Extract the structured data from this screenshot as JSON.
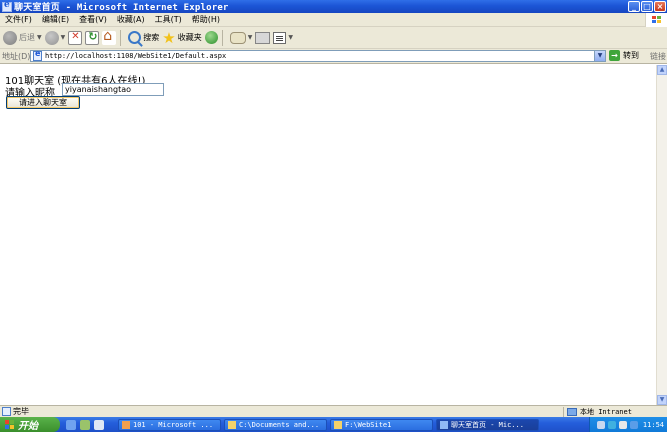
{
  "window": {
    "title": "聊天室首页 - Microsoft Internet Explorer",
    "min": "_",
    "max": "□",
    "close": "×"
  },
  "menu": [
    "文件(F)",
    "编辑(E)",
    "查看(V)",
    "收藏(A)",
    "工具(T)",
    "帮助(H)"
  ],
  "toolbar": {
    "back": "后退",
    "search": "搜索",
    "favorites": "收藏夹"
  },
  "address": {
    "label": "地址(D)",
    "url": "http://localhost:1108/WebSite1/Default.aspx",
    "go": "转到",
    "links": "链接"
  },
  "page": {
    "room_title": "101聊天室 (现在共有6人在线!)",
    "nick_label": "请输入昵称",
    "nick_value": "yiyanaishangtao",
    "enter_button": "请进入聊天室"
  },
  "status": {
    "text": "完毕",
    "zone": "本地 Intranet"
  },
  "taskbar": {
    "start": "开始",
    "tasks": [
      "101 - Microsoft ...",
      "C:\\Documents and...",
      "F:\\WebSite1",
      "聊天室首页 - Mic..."
    ],
    "clock": "11:54"
  },
  "colors": {
    "titlebar": "#1c55d6",
    "chrome": "#ece9d8",
    "taskbar": "#245edb",
    "start": "#3a8f2c"
  }
}
